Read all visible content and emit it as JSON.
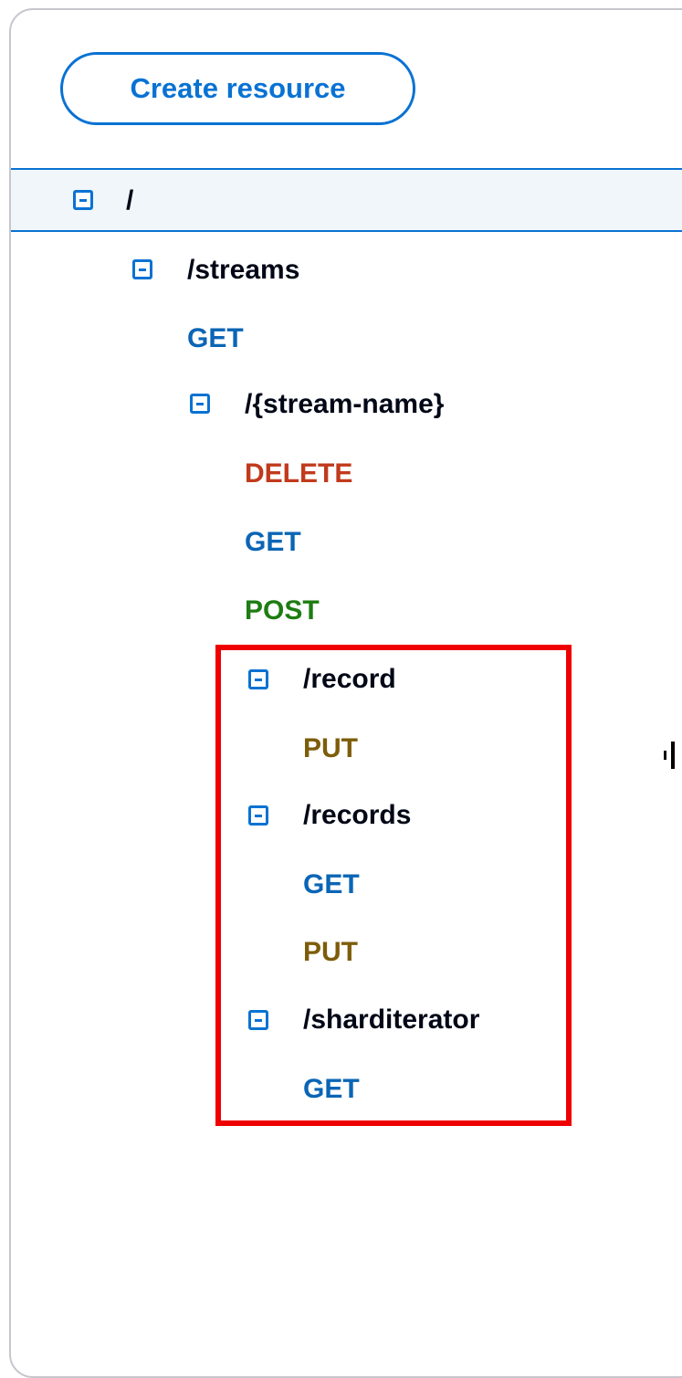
{
  "create_resource_label": "Create resource",
  "tree": {
    "root": {
      "label": "/"
    },
    "streams": {
      "label": "/streams"
    },
    "streams_get": {
      "label": "GET"
    },
    "stream_name": {
      "label": "/{stream-name}"
    },
    "stream_name_delete": {
      "label": "DELETE"
    },
    "stream_name_get": {
      "label": "GET"
    },
    "stream_name_post": {
      "label": "POST"
    },
    "record": {
      "label": "/record"
    },
    "record_put": {
      "label": "PUT"
    },
    "records": {
      "label": "/records"
    },
    "records_get": {
      "label": "GET"
    },
    "records_put": {
      "label": "PUT"
    },
    "sharditerator": {
      "label": "/sharditerator"
    },
    "sharditerator_get": {
      "label": "GET"
    }
  },
  "colors": {
    "accent": "#0972d3",
    "method_get": "#0a65b5",
    "method_delete": "#c13a1c",
    "method_post": "#1d7c12",
    "method_put": "#7d5d0a",
    "highlight_box": "#ee0000"
  },
  "icons": {
    "toggle": "collapse-minus-square-icon"
  }
}
